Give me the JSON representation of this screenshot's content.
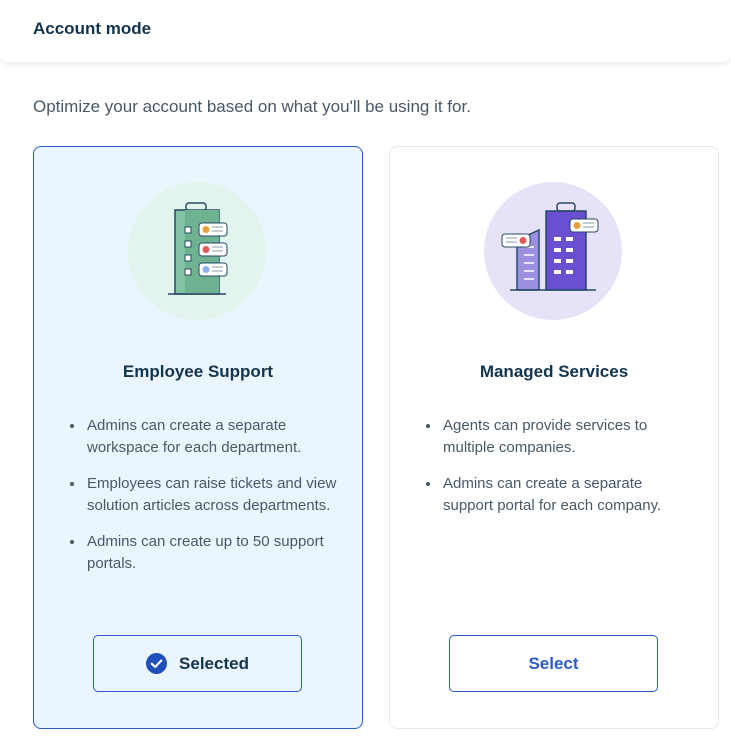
{
  "header": {
    "title": "Account mode"
  },
  "subtitle": "Optimize your account based on what you'll be using it for.",
  "cards": [
    {
      "title": "Employee Support",
      "bullets": [
        "Admins can create a separate workspace for each department.",
        "Employees can raise tickets and view solution articles across departments.",
        "Admins can create up to 50 support portals."
      ],
      "button_label": "Selected",
      "selected": true,
      "icon": "office-building-green-icon"
    },
    {
      "title": "Managed Services",
      "bullets": [
        "Agents can provide services to multiple companies.",
        "Admins can create a separate support portal for each company."
      ],
      "button_label": "Select",
      "selected": false,
      "icon": "multi-building-purple-icon"
    }
  ],
  "colors": {
    "accent": "#2c5cc5",
    "selected_bg": "#ebf5ff",
    "text_dark": "#12344d",
    "text_body": "#475867"
  }
}
